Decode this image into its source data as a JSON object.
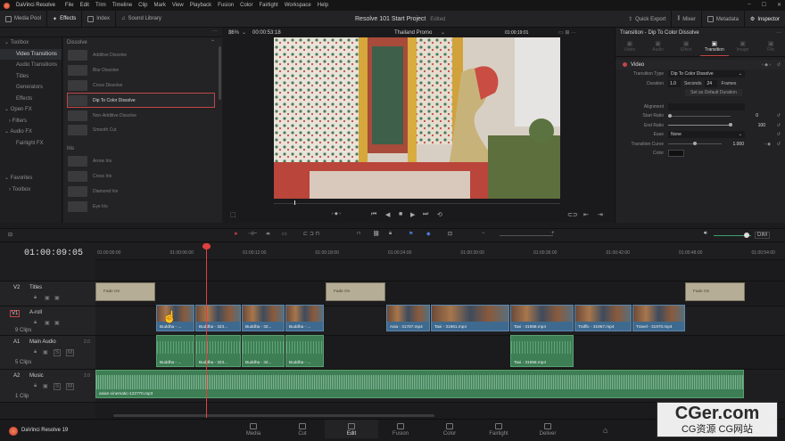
{
  "app": {
    "name": "DaVinci Resolve"
  },
  "menu": [
    "File",
    "Edit",
    "Trim",
    "Timeline",
    "Clip",
    "Mark",
    "View",
    "Playback",
    "Fusion",
    "Color",
    "Fairlight",
    "Workspace",
    "Help"
  ],
  "toolbar": {
    "media_pool": "Media Pool",
    "effects": "Effects",
    "index": "Index",
    "sound_library": "Sound Library",
    "project_title": "Resolve 101 Start Project",
    "edited": "Edited",
    "quick_export": "Quick Export",
    "mixer": "Mixer",
    "metadata": "Metadata",
    "inspector": "Inspector"
  },
  "left_nav": {
    "items": [
      {
        "label": "Toolbox",
        "kind": "hd"
      },
      {
        "label": "Video Transitions",
        "kind": "sel"
      },
      {
        "label": "Audio Transitions",
        "kind": ""
      },
      {
        "label": "Titles",
        "kind": ""
      },
      {
        "label": "Generators",
        "kind": ""
      },
      {
        "label": "Effects",
        "kind": ""
      },
      {
        "label": "Open FX",
        "kind": "hd"
      },
      {
        "label": "Filters",
        "kind": ""
      },
      {
        "label": "Audio FX",
        "kind": "hd"
      },
      {
        "label": "Fairlight FX",
        "kind": ""
      }
    ],
    "favorites": "Favorites",
    "fav_toolbox": "Toolbox"
  },
  "effects_list": {
    "dissolve_header": "Dissolve",
    "dissolve": [
      {
        "label": "Additive Dissolve",
        "sel": false
      },
      {
        "label": "Blur Dissolve",
        "sel": false
      },
      {
        "label": "Cross Dissolve",
        "sel": false
      },
      {
        "label": "Dip To Color Dissolve",
        "sel": true
      },
      {
        "label": "Non-Additive Dissolve",
        "sel": false
      },
      {
        "label": "Smooth Cut",
        "sel": false
      }
    ],
    "iris_header": "Iris",
    "iris": [
      {
        "label": "Arrow Iris",
        "sel": false
      },
      {
        "label": "Cross Iris",
        "sel": false
      },
      {
        "label": "Diamond Iris",
        "sel": false
      },
      {
        "label": "Eye Iris",
        "sel": false
      }
    ]
  },
  "viewer": {
    "zoom": "36%",
    "timecode": "00:00:53:18",
    "clip_name": "Thailand Promo",
    "source_tc": "01:00:19:01"
  },
  "inspector": {
    "title": "Transition - Dip To Color Dissolve",
    "tabs": [
      "Video",
      "Audio",
      "Effect",
      "Transition",
      "Image",
      "File"
    ],
    "active_tab": "Transition",
    "section": "Video",
    "transition_type_label": "Transition Type",
    "transition_type": "Dip To Color Dissolve",
    "duration_label": "Duration",
    "duration_seconds": "1.0",
    "seconds_label": "Seconds",
    "duration_frames": "24",
    "frames_label": "Frames",
    "set_default": "Set as Default Duration",
    "alignment_label": "Alignment",
    "start_ratio_label": "Start Ratio",
    "start_ratio": "0",
    "end_ratio_label": "End Ratio",
    "end_ratio": "100",
    "ease_label": "Ease",
    "ease": "None",
    "curve_label": "Transition Curve",
    "curve": "1.000",
    "color_label": "Color",
    "color_value": "#111111"
  },
  "timeline": {
    "timecode": "01:00:09:05",
    "volume": "DIM",
    "ruler": [
      "01:00:00:00",
      "01:00:06:00",
      "01:00:12:00",
      "01:00:18:00",
      "01:00:24:00",
      "01:00:30:00",
      "01:00:36:00",
      "01:00:42:00",
      "01:00:48:00",
      "01:00:54:00"
    ],
    "tracks": {
      "v2": {
        "id": "V2",
        "name": "Titles"
      },
      "v1": {
        "id": "V1",
        "name": "A-roll",
        "count": "9 Clips"
      },
      "a1": {
        "id": "A1",
        "name": "Main Audio",
        "count": "5 Clips",
        "channels": "2.0"
      },
      "a2": {
        "id": "A2",
        "name": "Music",
        "count": "1 Clip",
        "channels": "2.0"
      }
    },
    "title_clips": [
      "Fade On",
      "Fade On",
      "Fade On"
    ],
    "video_clips": [
      "Buddha - ...",
      "Buddha - 323...",
      "Buddha - 32...",
      "Buddha - ...",
      "Asia - 31787.mp4",
      "Taxi - 31961.mp4",
      "Taxi - 31958.mp4",
      "Traffic - 31967.mp4",
      "Travel - 31970.mp4"
    ],
    "audio_clips": [
      "Buddha - ...",
      "Buddha - 323...",
      "Buddha - 32...",
      "Buddha - ...",
      "Taxi - 31958.mp4"
    ],
    "music_clip": "asian-cinematic-122770.mp3"
  },
  "pages": [
    "Media",
    "Cut",
    "Edit",
    "Fusion",
    "Color",
    "Fairlight",
    "Deliver"
  ],
  "active_page": "Edit",
  "version": "DaVinci Resolve 19",
  "watermark": {
    "line1": "CGer.com",
    "line2": "CG资源 CG网站"
  },
  "colors": {
    "accent": "#c24646",
    "video_clip": "#3f6a8f",
    "audio_clip": "#3d7e55",
    "title_clip": "#b5ad95",
    "playhead": "#e04040"
  }
}
